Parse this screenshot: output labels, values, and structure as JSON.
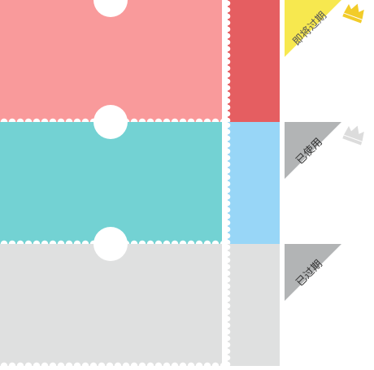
{
  "coupons": [
    {
      "status_label": "即将过期",
      "main_color": "#f99a9b",
      "stub_color": "#e55e61",
      "badge_color": "#f7e84f",
      "badge_text_color": "#555555",
      "crown_icon": "crown-icon",
      "crown_color": "#f2cc29"
    },
    {
      "status_label": "已使用",
      "main_color": "#73d2d3",
      "stub_color": "#98d6f7",
      "badge_color": "#b2b4b5",
      "badge_text_color": "#333333",
      "crown_icon": "crown-icon",
      "crown_color": "#dcdcdc"
    },
    {
      "status_label": "已过期",
      "main_color": "#dfe0e0",
      "stub_color": "#dfe0e0",
      "badge_color": "#b2b4b5",
      "badge_text_color": "#333333"
    }
  ]
}
